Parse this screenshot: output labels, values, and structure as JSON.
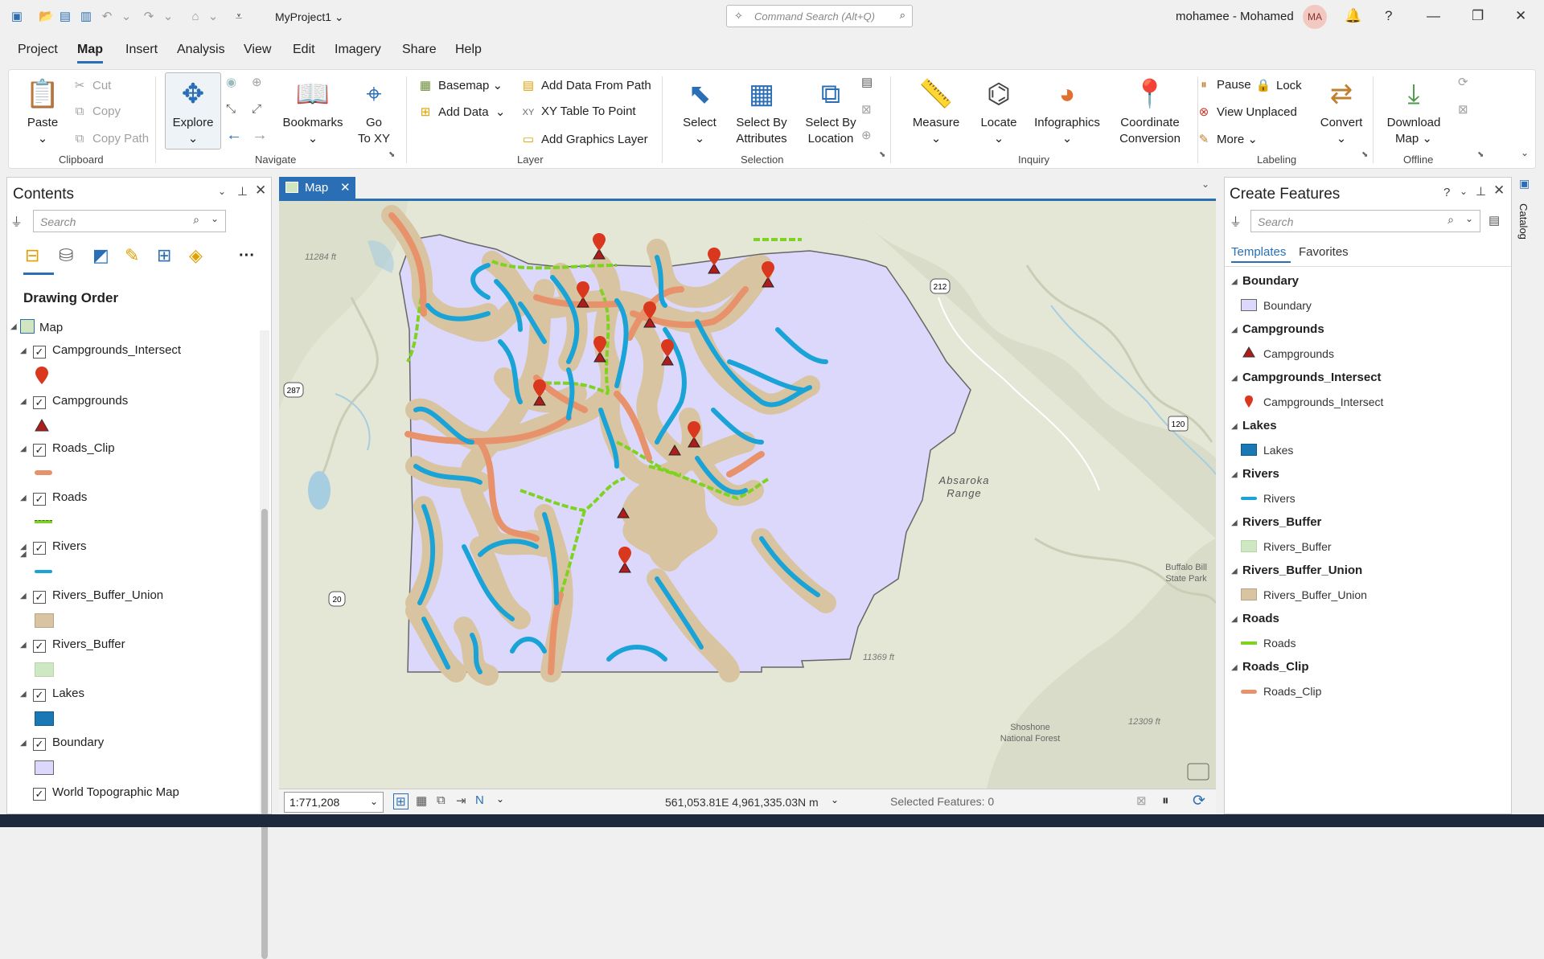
{
  "titlebar": {
    "project": "MyProject1 ⌄",
    "command_search": "Command Search (Alt+Q)",
    "user": "mohamee - Mohamed",
    "avatar": "MA"
  },
  "menu": [
    "Project",
    "Map",
    "Insert",
    "Analysis",
    "View",
    "Edit",
    "Imagery",
    "Share",
    "Help"
  ],
  "ribbon": {
    "clipboard": {
      "group": "Clipboard",
      "paste": "Paste",
      "cut": "Cut",
      "copy": "Copy",
      "copy_path": "Copy Path"
    },
    "navigate": {
      "group": "Navigate",
      "explore": "Explore",
      "bookmarks": "Bookmarks",
      "go_to_xy_1": "Go",
      "go_to_xy_2": "To XY"
    },
    "layer": {
      "group": "Layer",
      "basemap": "Basemap",
      "add_data": "Add Data",
      "add_data_from_path": "Add Data From Path",
      "xy_table": "XY Table To Point",
      "add_graphics": "Add Graphics Layer"
    },
    "selection": {
      "group": "Selection",
      "select": "Select",
      "sba_1": "Select By",
      "sba_2": "Attributes",
      "sbl_1": "Select By",
      "sbl_2": "Location"
    },
    "inquiry": {
      "group": "Inquiry",
      "measure": "Measure",
      "locate": "Locate",
      "infographics": "Infographics",
      "cc_1": "Coordinate",
      "cc_2": "Conversion"
    },
    "labeling": {
      "group": "Labeling",
      "pause": "Pause",
      "lock": "Lock",
      "view_unplaced": "View Unplaced",
      "more": "More",
      "convert": "Convert"
    },
    "offline": {
      "group": "Offline",
      "download_1": "Download",
      "download_2": "Map"
    }
  },
  "contents": {
    "title": "Contents",
    "search": "Search",
    "drawing_order": "Drawing Order",
    "map": "Map",
    "layers": [
      "Campgrounds_Intersect",
      "Campgrounds",
      "Roads_Clip",
      "Roads",
      "Rivers",
      "Rivers_Buffer_Union",
      "Rivers_Buffer",
      "Lakes",
      "Boundary",
      "World Topographic Map"
    ]
  },
  "map_tab": "Map",
  "map_labels": {
    "elev1": "11284 ft",
    "elev2": "11369 ft",
    "elev3": "12309 ft",
    "range1": "Absaroka",
    "range2": "Range",
    "park1": "Buffalo Bill",
    "park2": "State Park",
    "forest1": "Shoshone",
    "forest2": "National Forest",
    "hw212": "212",
    "hw287": "287",
    "hw120": "120",
    "hw20": "20"
  },
  "status": {
    "scale": "1:771,208",
    "coords": "561,053.81E 4,961,335.03N m",
    "selected": "Selected Features: 0"
  },
  "create": {
    "title": "Create Features",
    "search": "Search",
    "tab_templates": "Templates",
    "tab_favorites": "Favorites",
    "groups": [
      {
        "h": "Boundary",
        "i": "Boundary"
      },
      {
        "h": "Campgrounds",
        "i": "Campgrounds"
      },
      {
        "h": "Campgrounds_Intersect",
        "i": "Campgrounds_Intersect"
      },
      {
        "h": "Lakes",
        "i": "Lakes"
      },
      {
        "h": "Rivers",
        "i": "Rivers"
      },
      {
        "h": "Rivers_Buffer",
        "i": "Rivers_Buffer"
      },
      {
        "h": "Rivers_Buffer_Union",
        "i": "Rivers_Buffer_Union"
      },
      {
        "h": "Roads",
        "i": "Roads"
      },
      {
        "h": "Roads_Clip",
        "i": "Roads_Clip"
      }
    ]
  },
  "catalog_tab": "Catalog",
  "colors": {
    "accent": "#2a6fb5",
    "boundary": "#dcd8fb",
    "buffer_union": "#d8c4a0",
    "rivers": "#1aa3d6",
    "roads": "#7ed321",
    "roads_clip": "#e8926c",
    "campground": "#b01c1c",
    "lakes": "#1a78b4"
  }
}
